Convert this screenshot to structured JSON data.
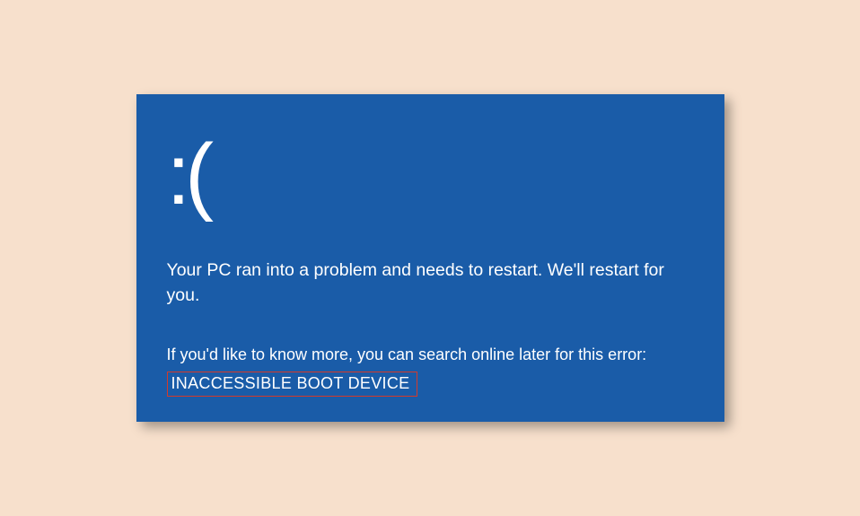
{
  "bsod": {
    "sad_face": ":(",
    "message_primary": "Your PC ran into a problem and needs to restart. We'll restart for you.",
    "message_secondary": "If you'd like to know more, you can search online later for this error:",
    "error_code": "INACCESSIBLE BOOT DEVICE"
  }
}
